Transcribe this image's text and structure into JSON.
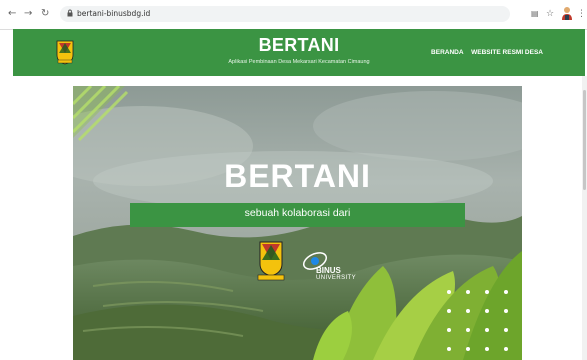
{
  "browser": {
    "url": "bertani-binusbdg.id",
    "icons": {
      "back": "arrow-left-icon",
      "forward": "arrow-right-icon",
      "reload": "reload-icon",
      "lock": "lock-icon",
      "translate": "translate-icon",
      "bookmark": "star-icon",
      "profile": "avatar-icon",
      "menu": "kebab-menu-icon"
    }
  },
  "header": {
    "title": "BERTANI",
    "subtitle": "Aplikasi Pembinaan Desa Mekarsari Kecamatan Cimaung",
    "nav": [
      "BERANDA",
      "WEBSITE RESMI DESA"
    ],
    "bg_color": "#3b9443"
  },
  "hero": {
    "title": "BERTANI",
    "collab_text": "sebuah kolaborasi dari",
    "partner_name": "BINUS",
    "partner_sub": "UNIVERSITY",
    "accent_color": "#3b9443",
    "logos": [
      "kabupaten-bandung-crest",
      "binus-university-logo"
    ]
  }
}
